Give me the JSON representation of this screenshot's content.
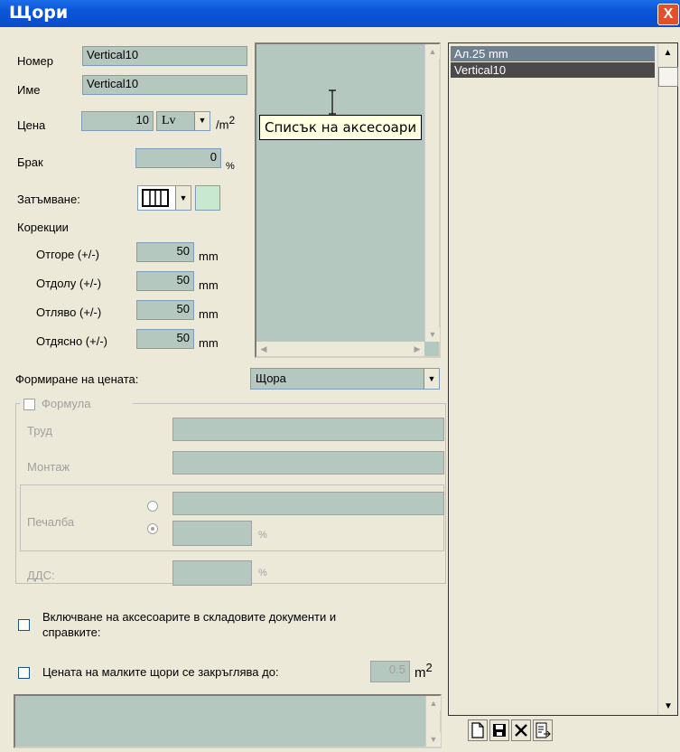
{
  "window": {
    "title": "Щори",
    "close_label": "X"
  },
  "form": {
    "number_label": "Номер",
    "number_value": "Vertical10",
    "name_label": "Име",
    "name_value": "Vertical10",
    "price_label": "Цена",
    "price_value": "10",
    "currency": "Lv",
    "price_unit": "/m",
    "price_unit_sup": "2",
    "waste_label": "Брак",
    "waste_value": "0",
    "waste_unit": "%",
    "shading_label": "Затъмване:",
    "corrections_label": "Корекции",
    "top_label": "Отгоре (+/-)",
    "top_value": "50",
    "bottom_label": "Отдолу (+/-)",
    "bottom_value": "50",
    "left_label": "Отляво (+/-)",
    "left_value": "50",
    "right_label": "Отдясно (+/-)",
    "right_value": "50",
    "mm": "mm",
    "pricing_label": "Формиране на цената:",
    "pricing_value": "Щора"
  },
  "formula": {
    "label": "Формула",
    "labour_label": "Труд",
    "install_label": "Монтаж",
    "profit_label": "Печалба",
    "percent": "%",
    "vat_label": "ДДС:"
  },
  "options": {
    "include_label_line1": "Включване на аксесоарите в складовите документи и",
    "include_label_line2": "справките:",
    "round_label": "Цената на малките щори се закръглява до:",
    "round_value": "0.5",
    "round_unit": "m",
    "round_unit_sup": "2"
  },
  "tooltip": "Списък на аксесоари",
  "list": {
    "items": [
      {
        "label": "Ал.25 mm",
        "bg": "#6e8090"
      },
      {
        "label": "Vertical10",
        "bg": "#4a4a4a"
      }
    ]
  },
  "toolbar": {
    "new": "new-icon",
    "save": "save-icon",
    "delete": "delete-icon",
    "export": "export-icon"
  },
  "colors": {
    "field_bg": "#b4c8c0",
    "shade_swatch": "#c8e8d0",
    "title_bar": "#0a55d8"
  }
}
